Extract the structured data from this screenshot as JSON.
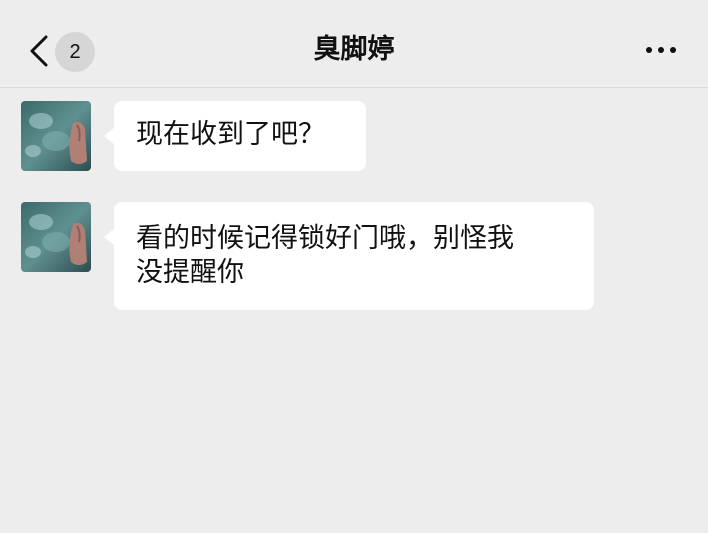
{
  "header": {
    "back_icon": "chevron-left-icon",
    "unread_count": "2",
    "title": "臭脚婷",
    "more_icon": "more-horizontal-icon"
  },
  "messages": [
    {
      "sender": "contact",
      "text": "现在收到了吧？"
    },
    {
      "sender": "contact",
      "text_line1": "看的时候记得锁好门哦，别怪我",
      "text_line2": "没提醒你"
    }
  ],
  "colors": {
    "background": "#ededed",
    "bubble": "#ffffff",
    "badge": "#d6d6d6",
    "text": "#111111"
  }
}
